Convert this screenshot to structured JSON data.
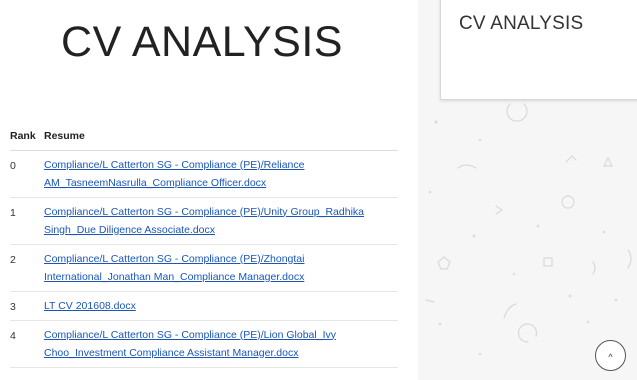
{
  "main": {
    "title": "CV ANALYSIS",
    "table": {
      "headers": {
        "rank": "Rank",
        "resume": "Resume"
      },
      "rows": [
        {
          "rank": "0",
          "line1": "Compliance/L Catterton SG - Compliance (PE)/Reliance",
          "line2": "AM_TasneemNasrulla_Compliance Officer.docx"
        },
        {
          "rank": "1",
          "line1": "Compliance/L Catterton SG - Compliance (PE)/Unity Group_Radhika",
          "line2": "Singh_Due Diligence Associate.docx"
        },
        {
          "rank": "2",
          "line1": "Compliance/L Catterton SG - Compliance (PE)/Zhongtai",
          "line2": "International_Jonathan Man_Compliance Manager.docx"
        },
        {
          "rank": "3",
          "line1": "LT CV 201608.docx",
          "line2": ""
        },
        {
          "rank": "4",
          "line1": "Compliance/L Catterton SG - Compliance (PE)/Lion Global_Ivy",
          "line2": "Choo_Investment Compliance Assistant Manager.docx"
        }
      ]
    }
  },
  "side_card": {
    "title": "CV ANALYSIS"
  },
  "scroll_top": {
    "icon": "chevron-up-icon",
    "glyph": "^"
  },
  "colors": {
    "link": "#1a56b8",
    "panel_bg": "#f6f6f6"
  }
}
